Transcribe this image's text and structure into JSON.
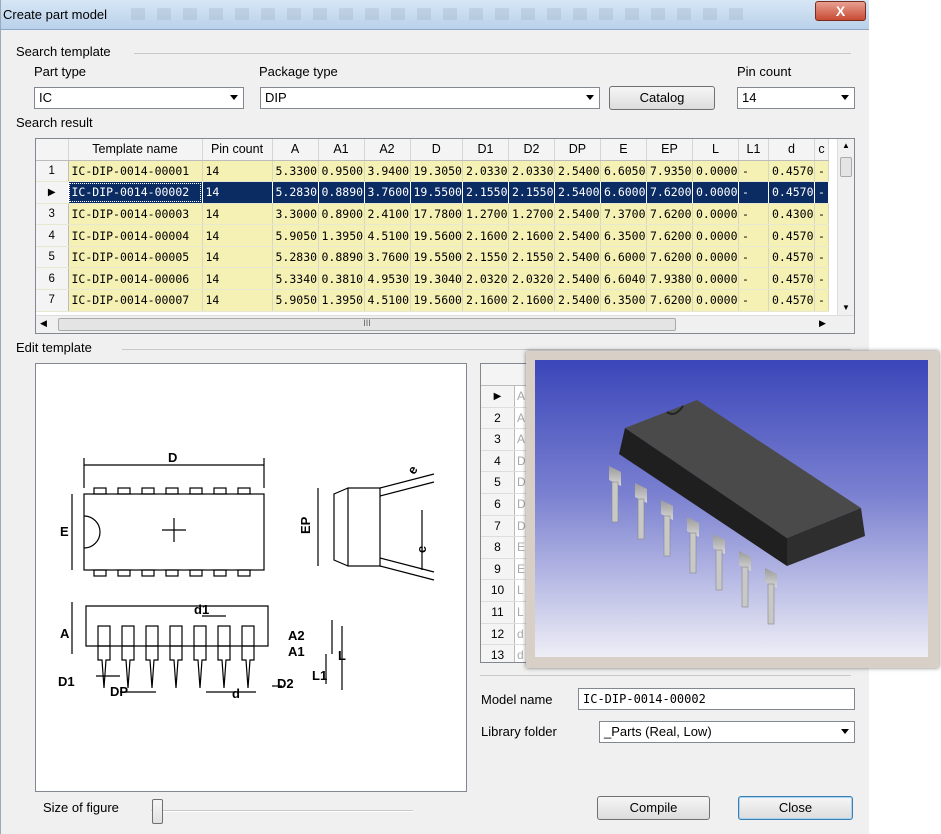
{
  "window": {
    "title": "Create part model",
    "close_glyph": "X"
  },
  "search_template": {
    "label": "Search template",
    "part_type": {
      "label": "Part type",
      "value": "IC"
    },
    "package_type": {
      "label": "Package type",
      "value": "DIP"
    },
    "catalog_button": "Catalog",
    "pin_count": {
      "label": "Pin count",
      "value": "14"
    }
  },
  "search_result": {
    "label": "Search result",
    "columns": [
      "Template name",
      "Pin count",
      "A",
      "A1",
      "A2",
      "D",
      "D1",
      "D2",
      "DP",
      "E",
      "EP",
      "L",
      "L1",
      "d",
      "c"
    ],
    "rows": [
      {
        "n": "1",
        "cells": [
          "IC-DIP-0014-00001",
          "14",
          "5.3300",
          "0.9500",
          "3.9400",
          "19.3050",
          "2.0330",
          "2.0330",
          "2.5400",
          "6.6050",
          "7.9350",
          "0.0000",
          "-",
          "0.4570",
          "-"
        ]
      },
      {
        "n": "",
        "cells": [
          "IC-DIP-0014-00002",
          "14",
          "5.2830",
          "0.8890",
          "3.7600",
          "19.5500",
          "2.1550",
          "2.1550",
          "2.5400",
          "6.6000",
          "7.6200",
          "0.0000",
          "-",
          "0.4570",
          "-"
        ]
      },
      {
        "n": "3",
        "cells": [
          "IC-DIP-0014-00003",
          "14",
          "3.3000",
          "0.8900",
          "2.4100",
          "17.7800",
          "1.2700",
          "1.2700",
          "2.5400",
          "7.3700",
          "7.6200",
          "0.0000",
          "-",
          "0.4300",
          "-"
        ]
      },
      {
        "n": "4",
        "cells": [
          "IC-DIP-0014-00004",
          "14",
          "5.9050",
          "1.3950",
          "4.5100",
          "19.5600",
          "2.1600",
          "2.1600",
          "2.5400",
          "6.3500",
          "7.6200",
          "0.0000",
          "-",
          "0.4570",
          "-"
        ]
      },
      {
        "n": "5",
        "cells": [
          "IC-DIP-0014-00005",
          "14",
          "5.2830",
          "0.8890",
          "3.7600",
          "19.5500",
          "2.1550",
          "2.1550",
          "2.5400",
          "6.6000",
          "7.6200",
          "0.0000",
          "-",
          "0.4570",
          "-"
        ]
      },
      {
        "n": "6",
        "cells": [
          "IC-DIP-0014-00006",
          "14",
          "5.3340",
          "0.3810",
          "4.9530",
          "19.3040",
          "2.0320",
          "2.0320",
          "2.5400",
          "6.6040",
          "7.9380",
          "0.0000",
          "-",
          "0.4570",
          "-"
        ]
      },
      {
        "n": "7",
        "cells": [
          "IC-DIP-0014-00007",
          "14",
          "5.9050",
          "1.3950",
          "4.5100",
          "19.5600",
          "2.1600",
          "2.1600",
          "2.5400",
          "6.3500",
          "7.6200",
          "0.0000",
          "-",
          "0.4570",
          "-"
        ]
      }
    ],
    "scroll_mark": "III"
  },
  "edit_template": {
    "label": "Edit template",
    "figure_labels": {
      "D": "D",
      "E": "E",
      "EP": "EP",
      "e": "e",
      "A": "A",
      "A1": "A1",
      "A2": "A2",
      "L": "L",
      "L1": "L1",
      "D1": "D1",
      "D2": "D2",
      "DP": "DP",
      "d": "d",
      "d1": "d1"
    },
    "param_rows": [
      {
        "n": "",
        "v": "A"
      },
      {
        "n": "2",
        "v": "A"
      },
      {
        "n": "3",
        "v": "A"
      },
      {
        "n": "4",
        "v": "D"
      },
      {
        "n": "5",
        "v": "D"
      },
      {
        "n": "6",
        "v": "D"
      },
      {
        "n": "7",
        "v": "D"
      },
      {
        "n": "8",
        "v": "E"
      },
      {
        "n": "9",
        "v": "E"
      },
      {
        "n": "10",
        "v": "L"
      },
      {
        "n": "11",
        "v": "L"
      },
      {
        "n": "12",
        "v": "d"
      },
      {
        "n": "13",
        "v": "d"
      }
    ],
    "model_name": {
      "label": "Model name",
      "value": "IC-DIP-0014-00002"
    },
    "library_folder": {
      "label": "Library folder",
      "value": "_Parts (Real, Low)"
    },
    "size_of_figure": "Size of figure",
    "compile_button": "Compile",
    "close_button": "Close"
  },
  "colors": {
    "selected_row": "#0b2b63",
    "row_bg": "#f5f0b3",
    "preview_top": "#3b46b9"
  }
}
